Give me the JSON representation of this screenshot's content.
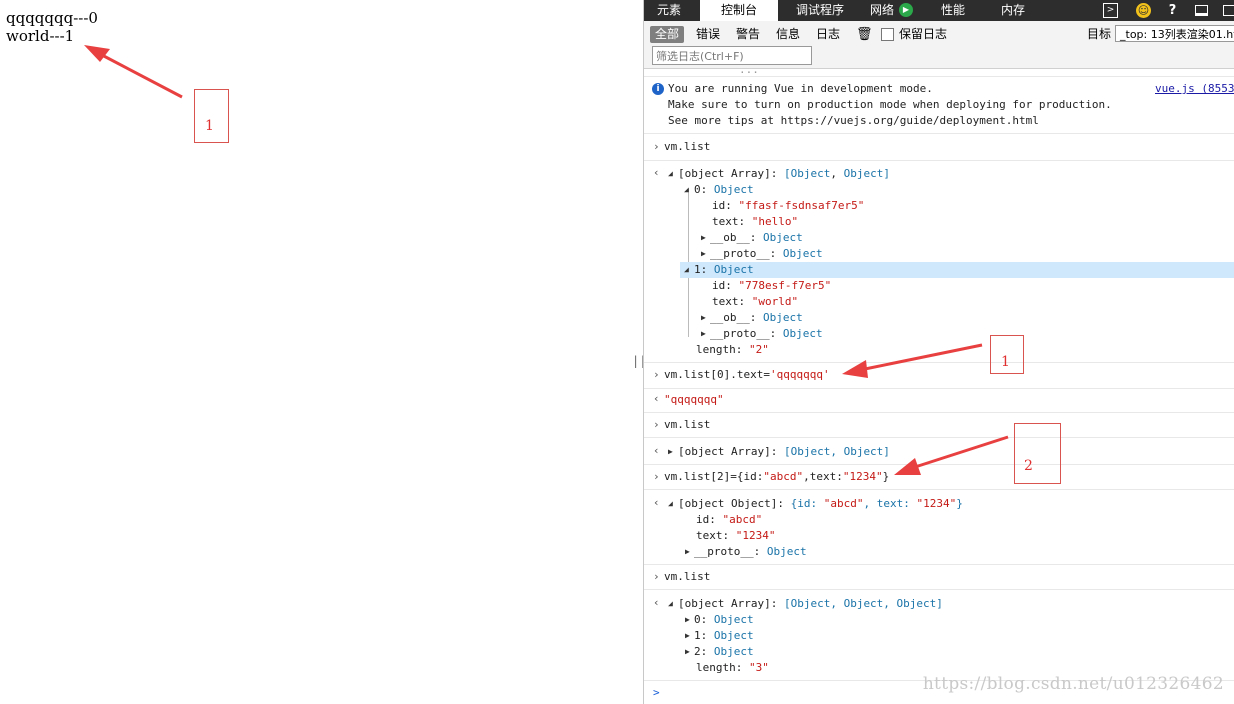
{
  "page": {
    "lines": [
      "qqqqqqq---0",
      "world---1"
    ]
  },
  "devtools": {
    "tabs": [
      "元素",
      "控制台",
      "调试程序",
      "网络",
      "性能",
      "内存"
    ],
    "toolbar_icons": [
      "console-drawer-icon",
      "smiley-feedback-icon",
      "help-icon",
      "dock-icon",
      "undock-icon",
      "network-record-icon"
    ],
    "levels": {
      "all": "全部",
      "errors": "错误",
      "warnings": "警告",
      "info": "信息",
      "logs": "日志",
      "preserve_log": "保留日志"
    },
    "filter_placeholder": "筛选日志(Ctrl+F)",
    "target_label": "目标",
    "target_value": "_top: 13列表渲染01.htm",
    "splitter": "||"
  },
  "console": {
    "truncated_top": "...",
    "vue_message": {
      "line1": "You are running Vue in development mode.",
      "line2": "Make sure to turn on production mode when deploying for production.",
      "line3": "See more tips at https://vuejs.org/guide/deployment.html",
      "source": "vue.js (8553"
    },
    "cmd1": "vm.list",
    "result1": {
      "head": "[object Array]:",
      "preview_open": "[",
      "preview_a": "Object",
      "preview_comma": ", ",
      "preview_b": "Object",
      "preview_close": "]",
      "item0_key": "0:",
      "item0_type": "Object",
      "item0_id_key": "id:",
      "item0_id_val": "\"ffasf-fsdnsaf7er5\"",
      "item0_text_key": "text:",
      "item0_text_val": "\"hello\"",
      "ob_key": "__ob__:",
      "proto_key": "__proto__:",
      "object_label": "Object",
      "item1_key": "1:",
      "item1_type": "Object",
      "item1_id_key": "id:",
      "item1_id_val": "\"778esf-f7er5\"",
      "item1_text_key": "text:",
      "item1_text_val": "\"world\"",
      "length_key": "length:",
      "length_val": "\"2\""
    },
    "cmd2_prefix": "vm.list[0].text=",
    "cmd2_value": "'qqqqqqq'",
    "result2": "\"qqqqqqq\"",
    "cmd3": "vm.list",
    "result3_head": "[object Array]:",
    "result3_preview": "[Object, Object]",
    "cmd4_prefix": "vm.list[2]={id:",
    "cmd4_id": "\"abcd\"",
    "cmd4_mid": ",text:",
    "cmd4_text": "\"1234\"",
    "cmd4_suffix": "}",
    "result4": {
      "head": "[object Object]:",
      "preview_a": "{id: ",
      "preview_id": "\"abcd\"",
      "preview_b": ", text: ",
      "preview_text": "\"1234\"",
      "preview_c": "}",
      "id_key": "id:",
      "id_val": "\"abcd\"",
      "text_key": "text:",
      "text_val": "\"1234\"",
      "proto_key": "__proto__:",
      "proto_val": "Object"
    },
    "cmd5": "vm.list",
    "result5": {
      "head": "[object Array]:",
      "preview": "[Object, Object, Object]",
      "i0": "0:",
      "i1": "1:",
      "i2": "2:",
      "obj": "Object",
      "length_key": "length:",
      "length_val": "\"3\""
    },
    "prompt": ">"
  },
  "annotations": {
    "box_left": "1",
    "box_right1": "1",
    "box_right2": "2",
    "color": "#e03030"
  },
  "watermark": "https://blog.csdn.net/u012326462"
}
